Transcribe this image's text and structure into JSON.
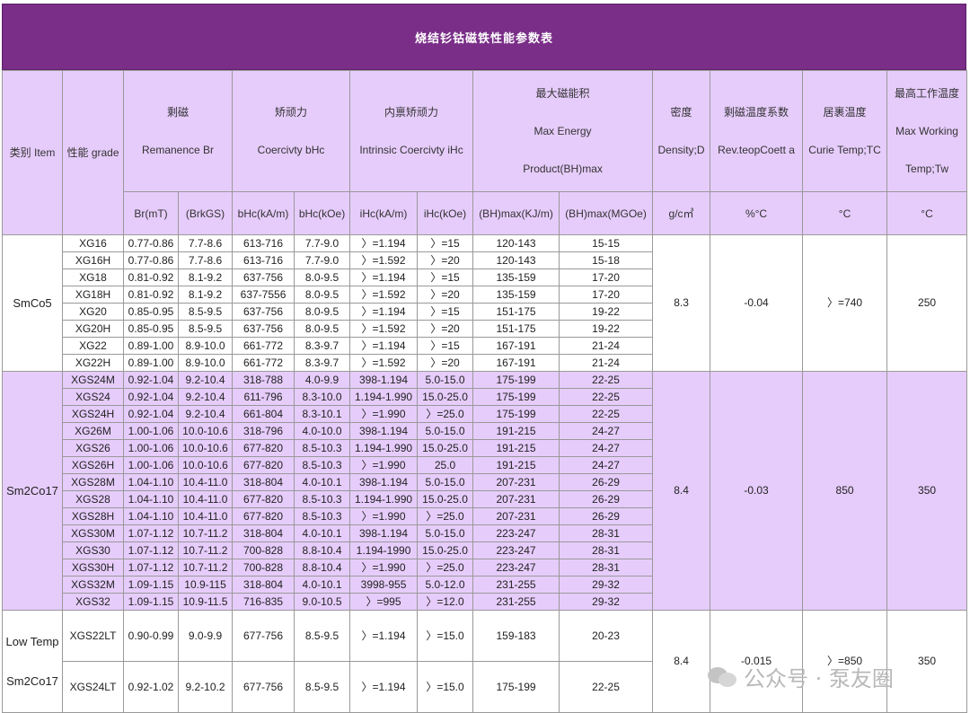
{
  "title": "烧结钐钴磁铁性能参数表",
  "headers": {
    "category": "类别 Item",
    "grade": "性能 grade",
    "remanence": [
      "剩磁",
      "Remanence Br"
    ],
    "coercivity": [
      "矫顽力",
      "Coercivty bHc"
    ],
    "intrinsic": [
      "内禀矫顽力",
      "Intrinsic Coercivty iHc"
    ],
    "energy": [
      "最大磁能积",
      "Max Energy",
      "Product(BH)max"
    ],
    "density": [
      "密度",
      "Density;D"
    ],
    "temp_coeff": [
      "剩磁温度系数",
      "Rev.teopCoett a"
    ],
    "curie": [
      "居裹温度",
      "Curie Temp;TC"
    ],
    "working": [
      "最高工作温度",
      "Max Working",
      "Temp;Tw"
    ]
  },
  "units": [
    "Br(mT)",
    "(BrkGS)",
    "bHc(kA/m)",
    "bHc(kOe)",
    "iHc(kA/m)",
    "iHc(kOe)",
    "(BH)max(KJ/m)",
    "(BH)max(MGOe)",
    "g/c㎥",
    "%°C",
    "°C",
    "°C"
  ],
  "groups": [
    {
      "category": "SmCo5",
      "density": "8.3",
      "temp_coeff": "-0.04",
      "curie": "〉=740",
      "working": "250",
      "rows": [
        [
          "XG16",
          "0.77-0.86",
          "7.7-8.6",
          "613-716",
          "7.7-9.0",
          "〉=1.194",
          "〉=15",
          "120-143",
          "15-15"
        ],
        [
          "XG16H",
          "0.77-0.86",
          "7.7-8.6",
          "613-716",
          "7.7-9.0",
          "〉=1.592",
          "〉=20",
          "120-143",
          "15-18"
        ],
        [
          "XG18",
          "0.81-0.92",
          "8.1-9.2",
          "637-756",
          "8.0-9.5",
          "〉=1.194",
          "〉=15",
          "135-159",
          "17-20"
        ],
        [
          "XG18H",
          "0.81-0.92",
          "8.1-9.2",
          "637-7556",
          "8.0-9.5",
          "〉=1.592",
          "〉=20",
          "135-159",
          "17-20"
        ],
        [
          "XG20",
          "0.85-0.95",
          "8.5-9.5",
          "637-756",
          "8.0-9.5",
          "〉=1.194",
          "〉=15",
          "151-175",
          "19-22"
        ],
        [
          "XG20H",
          "0.85-0.95",
          "8.5-9.5",
          "637-756",
          "8.0-9.5",
          "〉=1.592",
          "〉=20",
          "151-175",
          "19-22"
        ],
        [
          "XG22",
          "0.89-1.00",
          "8.9-10.0",
          "661-772",
          "8.3-9.7",
          "〉=1.194",
          "〉=15",
          "167-191",
          "21-24"
        ],
        [
          "XG22H",
          "0.89-1.00",
          "8.9-10.0",
          "661-772",
          "8.3-9.7",
          "〉=1.592",
          "〉=20",
          "167-191",
          "21-24"
        ]
      ]
    },
    {
      "category": "Sm2Co17",
      "density": "8.4",
      "temp_coeff": "-0.03",
      "curie": "850",
      "working": "350",
      "rows": [
        [
          "XGS24M",
          "0.92-1.04",
          "9.2-10.4",
          "318-788",
          "4.0-9.9",
          "398-1.194",
          "5.0-15.0",
          "175-199",
          "22-25"
        ],
        [
          "XGS24",
          "0.92-1.04",
          "9.2-10.4",
          "611-796",
          "8.3-10.0",
          "1.194-1.990",
          "15.0-25.0",
          "175-199",
          "22-25"
        ],
        [
          "XGS24H",
          "0.92-1.04",
          "9.2-10.4",
          "661-804",
          "8.3-10.1",
          "〉=1.990",
          "〉=25.0",
          "175-199",
          "22-25"
        ],
        [
          "XG26M",
          "1.00-1.06",
          "10.0-10.6",
          "318-796",
          "4.0-10.0",
          "398-1.194",
          "5.0-15.0",
          "191-215",
          "24-27"
        ],
        [
          "XGS26",
          "1.00-1.06",
          "10.0-10.6",
          "677-820",
          "8.5-10.3",
          "1.194-1.990",
          "15.0-25.0",
          "191-215",
          "24-27"
        ],
        [
          "XGS26H",
          "1.00-1.06",
          "10.0-10.6",
          "677-820",
          "8.5-10.3",
          "〉=1.990",
          "25.0",
          "191-215",
          "24-27"
        ],
        [
          "XGS28M",
          "1.04-1.10",
          "10.4-11.0",
          "318-804",
          "4.0-10.1",
          "398-1.194",
          "5.0-15.0",
          "207-231",
          "26-29"
        ],
        [
          "XGS28",
          "1.04-1.10",
          "10.4-11.0",
          "677-820",
          "8.5-10.3",
          "1.194-1.990",
          "15.0-25.0",
          "207-231",
          "26-29"
        ],
        [
          "XGS28H",
          "1.04-1.10",
          "10.4-11.0",
          "677-820",
          "8.5-10.3",
          "〉=1.990",
          "〉=25.0",
          "207-231",
          "26-29"
        ],
        [
          "XGS30M",
          "1.07-1.12",
          "10.7-11.2",
          "318-804",
          "4.0-10.1",
          "398-1.194",
          "5.0-15.0",
          "223-247",
          "28-31"
        ],
        [
          "XGS30",
          "1.07-1.12",
          "10.7-11.2",
          "700-828",
          "8.8-10.4",
          "1.194-1990",
          "15.0-25.0",
          "223-247",
          "28-31"
        ],
        [
          "XGS30H",
          "1.07-1.12",
          "10.7-11.2",
          "700-828",
          "8.8-10.4",
          "〉=1.990",
          "〉=25.0",
          "223-247",
          "28-31"
        ],
        [
          "XGS32M",
          "1.09-1.15",
          "10.9-115",
          "318-804",
          "4.0-10.1",
          "3998-955",
          "5.0-12.0",
          "231-255",
          "29-32"
        ],
        [
          "XGS32",
          "1.09-1.15",
          "10.9-11.5",
          "716-835",
          "9.0-10.5",
          "〉=995",
          "〉=12.0",
          "231-255",
          "29-32"
        ]
      ]
    },
    {
      "category_lines": [
        "Low Temp",
        "Sm2Co17"
      ],
      "density": "8.4",
      "temp_coeff": "-0.015",
      "curie": "〉=850",
      "working": "350",
      "rows": [
        [
          "XGS22LT",
          "0.90-0.99",
          "9.0-9.9",
          "677-756",
          "8.5-9.5",
          "〉=1.194",
          "〉=15.0",
          "159-183",
          "20-23"
        ],
        [
          "XGS24LT",
          "0.92-1.02",
          "9.2-10.2",
          "677-756",
          "8.5-9.5",
          "〉=1.194",
          "〉=15.0",
          "175-199",
          "22-25"
        ]
      ]
    }
  ],
  "watermark": "公众号 · 泵友圈"
}
